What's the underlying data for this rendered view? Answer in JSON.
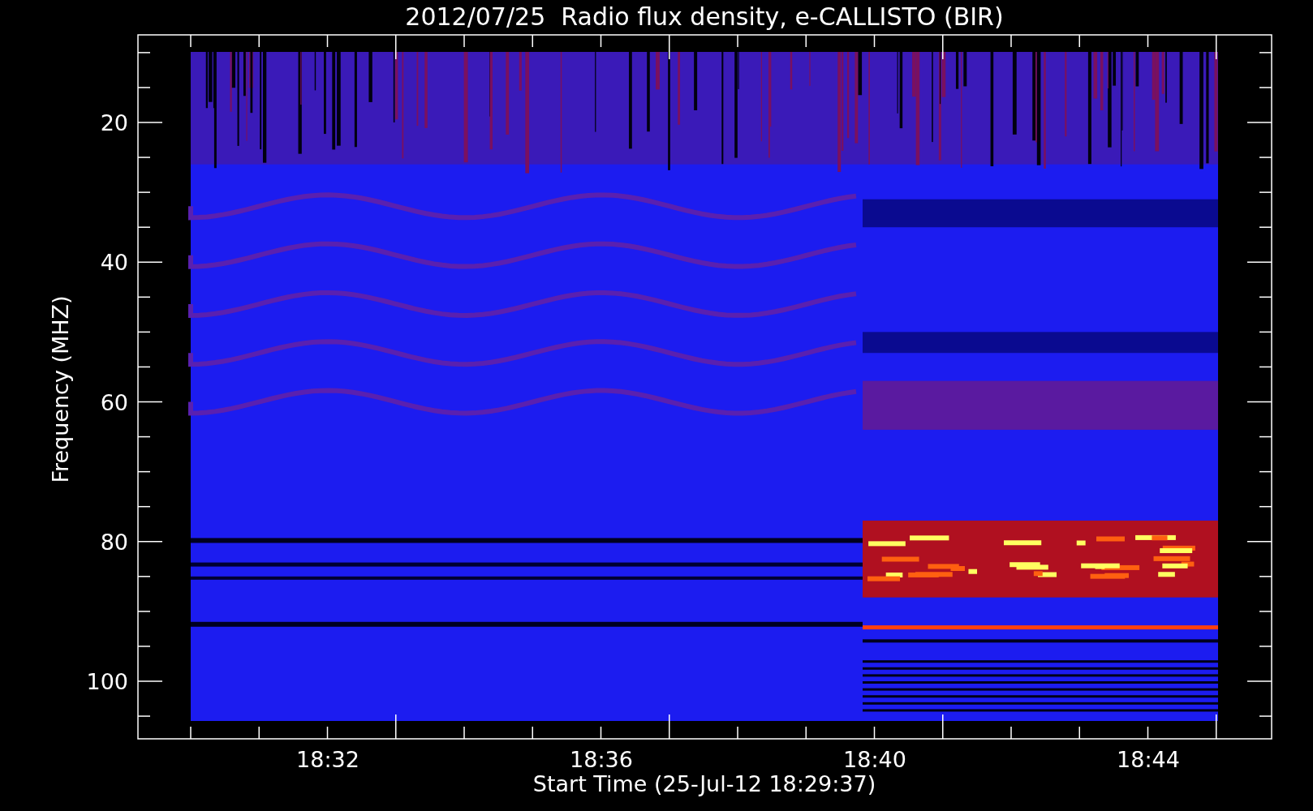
{
  "title": "2012/07/25  Radio flux density, e-CALLISTO (BIR)",
  "ylabel": "Frequency (MHZ)",
  "xlabel": "Start Time (25-Jul-12 18:29:37)",
  "yticks": [
    "20",
    "40",
    "60",
    "80",
    "100"
  ],
  "xticks": [
    "18:32",
    "18:36",
    "18:40",
    "18:44"
  ]
}
